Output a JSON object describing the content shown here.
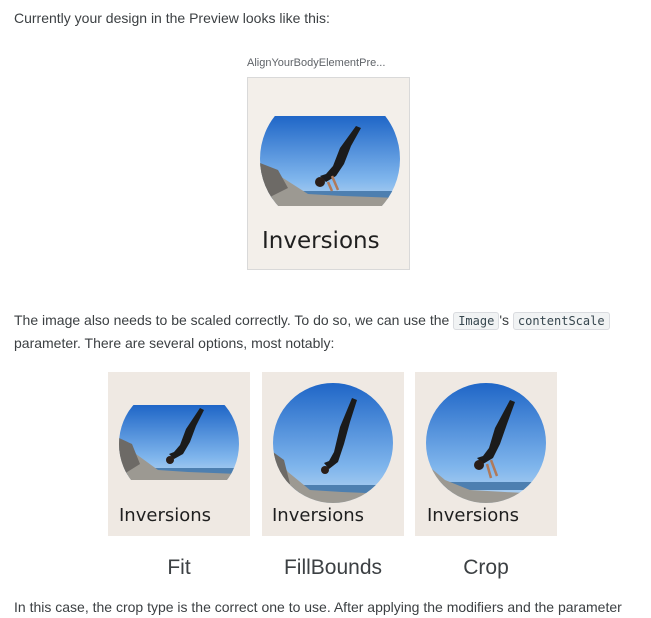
{
  "intro_text": "Currently your design in the Preview looks like this:",
  "preview": {
    "title": "AlignYourBodyElementPre...",
    "card_label": "Inversions"
  },
  "scale_paragraph": {
    "part1": "The image also needs to be scaled correctly. To do so, we can use the ",
    "code1": "Image",
    "part2": "'s ",
    "code2": "contentScale",
    "part3": " parameter. There are several options, most notably:"
  },
  "examples": [
    {
      "card_label": "Inversions",
      "caption": "Fit"
    },
    {
      "card_label": "Inversions",
      "caption": "FillBounds"
    },
    {
      "card_label": "Inversions",
      "caption": "Crop"
    }
  ],
  "cutoff_text": "In this case, the crop type is the correct one to use. After applying the modifiers and the parameter"
}
